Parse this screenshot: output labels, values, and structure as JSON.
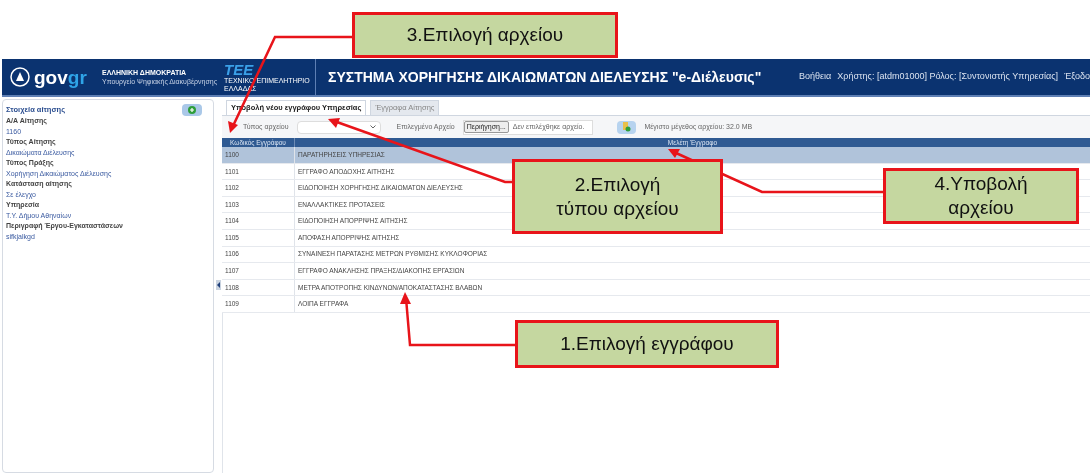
{
  "header": {
    "brand": "gov",
    "brand_accent": "gr",
    "ministry": "ΕΛΛΗΝΙΚΗ ΔΗΜΟΚΡΑΤΙΑ",
    "ministry_sub": "Υπουργείο Ψηφιακής Διακυβέρνησης",
    "tee": "ΤΕΕ",
    "tee_sub": "ΤΕΧΝΙΚΟ ΕΠΙΜΕΛΗΤΗΡΙΟ ΕΛΛΑΔΑΣ",
    "title": "ΣΥΣΤΗΜΑ ΧΟΡΗΓΗΣΗΣ ΔΙΚΑΙΩΜΑΤΩΝ ΔΙΕΛΕΥΣΗΣ \"e-Διέλευσις\"",
    "links": [
      "Βοήθεια",
      "Χρήστης: [atdm01000] Ρόλος: [Συντονιστής Υπηρεσίας]",
      "Έξοδο"
    ]
  },
  "sidebar": {
    "title": "Στοιχεία αίτησης",
    "fields": [
      {
        "label": "Α/Α Αίτησης",
        "value": "1160"
      },
      {
        "label": "Τύπος Αίτησης",
        "value": "Δικαιώματα Διέλευσης"
      },
      {
        "label": "Τύπος Πράξης",
        "value": "Χορήγηση Δικαιώματος Διέλευσης"
      },
      {
        "label": "Κατάσταση αίτησης",
        "value": "Σε έλεγχο"
      },
      {
        "label": "Υπηρεσία",
        "value": "Τ.Υ. Δήμου Αθηναίων"
      },
      {
        "label": "Περιγραφή Έργου-Εγκαταστάσεων",
        "value": "sifkjalkgd"
      }
    ]
  },
  "tabs": [
    {
      "label": "Υποβολή νέου εγγράφου Υπηρεσίας",
      "selected": true
    },
    {
      "label": "Έγγραφα Αίτησης",
      "selected": false
    }
  ],
  "toolbar": {
    "file_type_label": "Τύπος αρχείου",
    "selected_file_label": "Επιλεγμένο Αρχείο",
    "browse_button": "Περιήγηση...",
    "no_file": "Δεν επιλέχθηκε αρχείο.",
    "max_size": "Μέγιστο μέγεθος αρχείου: 32.0 MB"
  },
  "table": {
    "columns": [
      "Κωδικός Εγγράφου",
      "Μελέτη Έγγραφο"
    ],
    "rows": [
      {
        "code": "1100",
        "name": "ΠΑΡΑΤΗΡΗΣΕΙΣ ΥΠΗΡΕΣΙΑΣ",
        "selected": true
      },
      {
        "code": "1101",
        "name": "ΕΓΓΡΑΦΟ ΑΠΟΔΟΧΗΣ ΑΙΤΗΣΗΣ",
        "selected": false
      },
      {
        "code": "1102",
        "name": "ΕΙΔΟΠΟΙΗΣΗ ΧΟΡΗΓΗΣΗΣ ΔΙΚΑΙΩΜΑΤΩΝ ΔΙΕΛΕΥΣΗΣ",
        "selected": false
      },
      {
        "code": "1103",
        "name": "ΕΝΑΛΛΑΚΤΙΚΕΣ ΠΡΟΤΑΣΕΙΣ",
        "selected": false
      },
      {
        "code": "1104",
        "name": "ΕΙΔΟΠΟΙΗΣΗ ΑΠΟΡΡΙΨΗΣ ΑΙΤΗΣΗΣ",
        "selected": false
      },
      {
        "code": "1105",
        "name": "ΑΠΟΦΑΣΗ ΑΠΟΡΡΙΨΗΣ ΑΙΤΗΣΗΣ",
        "selected": false
      },
      {
        "code": "1106",
        "name": "ΣΥΝΑΙΝΕΣΗ ΠΑΡΑΤΑΣΗΣ ΜΕΤΡΩΝ ΡΥΘΜΙΣΗΣ ΚΥΚΛΟΦΟΡΙΑΣ",
        "selected": false
      },
      {
        "code": "1107",
        "name": "ΕΓΓΡΑΦΟ ΑΝΑΚΛΗΣΗΣ ΠΡΑΞΗΣ/ΔΙΑΚΟΠΗΣ ΕΡΓΑΣΙΩΝ",
        "selected": false
      },
      {
        "code": "1108",
        "name": "ΜΕΤΡΑ ΑΠΟΤΡΟΠΗΣ ΚΙΝΔΥΝΩΝ/ΑΠΟΚΑΤΑΣΤΑΣΗΣ ΒΛΑΒΩΝ",
        "selected": false
      },
      {
        "code": "1109",
        "name": "ΛΟΙΠΑ ΕΓΓΡΑΦΑ",
        "selected": false
      }
    ]
  },
  "annotations": [
    {
      "lines": [
        "3.Επιλογή αρχείου"
      ]
    },
    {
      "lines": [
        "2.Επιλογή",
        "τύπου αρχείου"
      ]
    },
    {
      "lines": [
        "4.Υποβολή",
        "αρχείου"
      ]
    },
    {
      "lines": [
        "1.Επιλογή εγγράφου"
      ]
    }
  ]
}
